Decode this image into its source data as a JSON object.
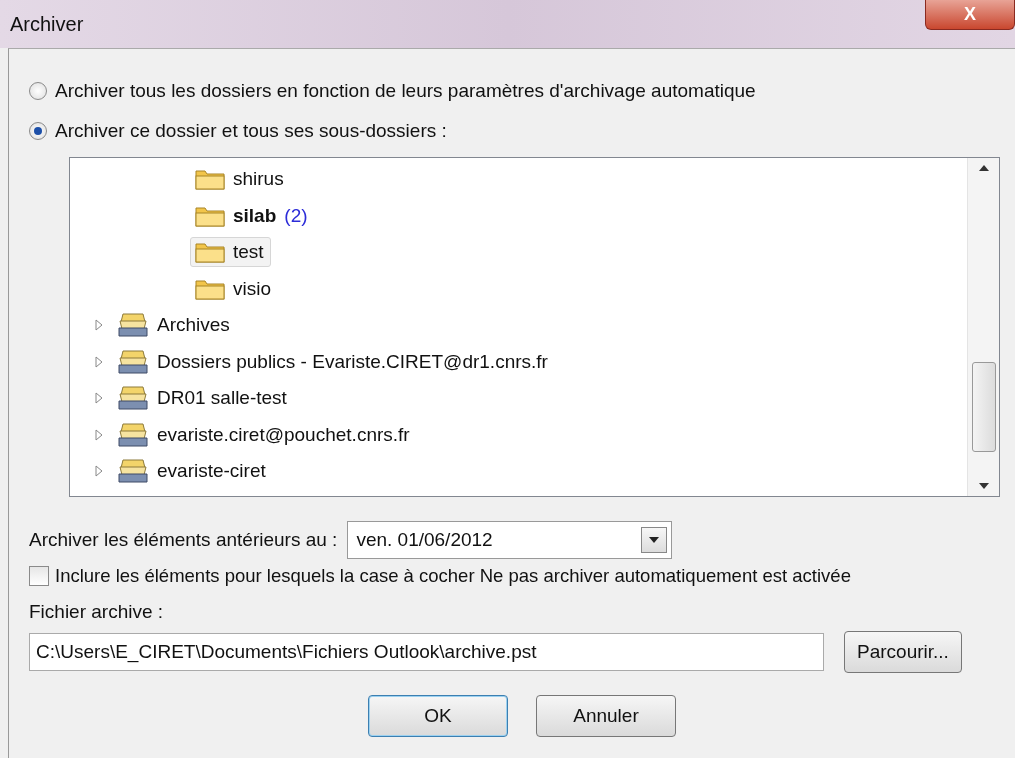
{
  "window": {
    "title": "Archiver",
    "close": "X"
  },
  "options": [
    {
      "label": "Archiver tous les dossiers en fonction de leurs paramètres d'archivage automatique",
      "selected": false
    },
    {
      "label": "Archiver ce dossier et tous ses sous-dossiers :",
      "selected": true
    }
  ],
  "tree": [
    {
      "kind": "folder",
      "label": "shirus",
      "bold": false,
      "selected": false
    },
    {
      "kind": "folder",
      "label": "silab",
      "count": "(2)",
      "bold": true,
      "selected": false
    },
    {
      "kind": "folder",
      "label": "test",
      "bold": false,
      "selected": true
    },
    {
      "kind": "folder",
      "label": "visio",
      "bold": false,
      "selected": false
    },
    {
      "kind": "store",
      "label": "Archives",
      "expanded": false
    },
    {
      "kind": "store",
      "label": "Dossiers publics - Evariste.CIRET@dr1.cnrs.fr",
      "expanded": false
    },
    {
      "kind": "store",
      "label": "DR01 salle-test",
      "expanded": false
    },
    {
      "kind": "store",
      "label": "evariste.ciret@pouchet.cnrs.fr",
      "expanded": false
    },
    {
      "kind": "store",
      "label": "evariste-ciret",
      "expanded": false
    }
  ],
  "date": {
    "label": "Archiver les éléments antérieurs au :",
    "value": "ven. 01/06/2012"
  },
  "include": {
    "label": "Inclure les éléments pour lesquels la case à cocher Ne pas archiver automatiquement est activée",
    "checked": false
  },
  "file": {
    "label": "Fichier archive :",
    "value": "C:\\Users\\E_CIRET\\Documents\\Fichiers Outlook\\archive.pst",
    "browse": "Parcourir..."
  },
  "buttons": [
    {
      "label": "OK",
      "default": true
    },
    {
      "label": "Annuler",
      "default": false
    }
  ]
}
